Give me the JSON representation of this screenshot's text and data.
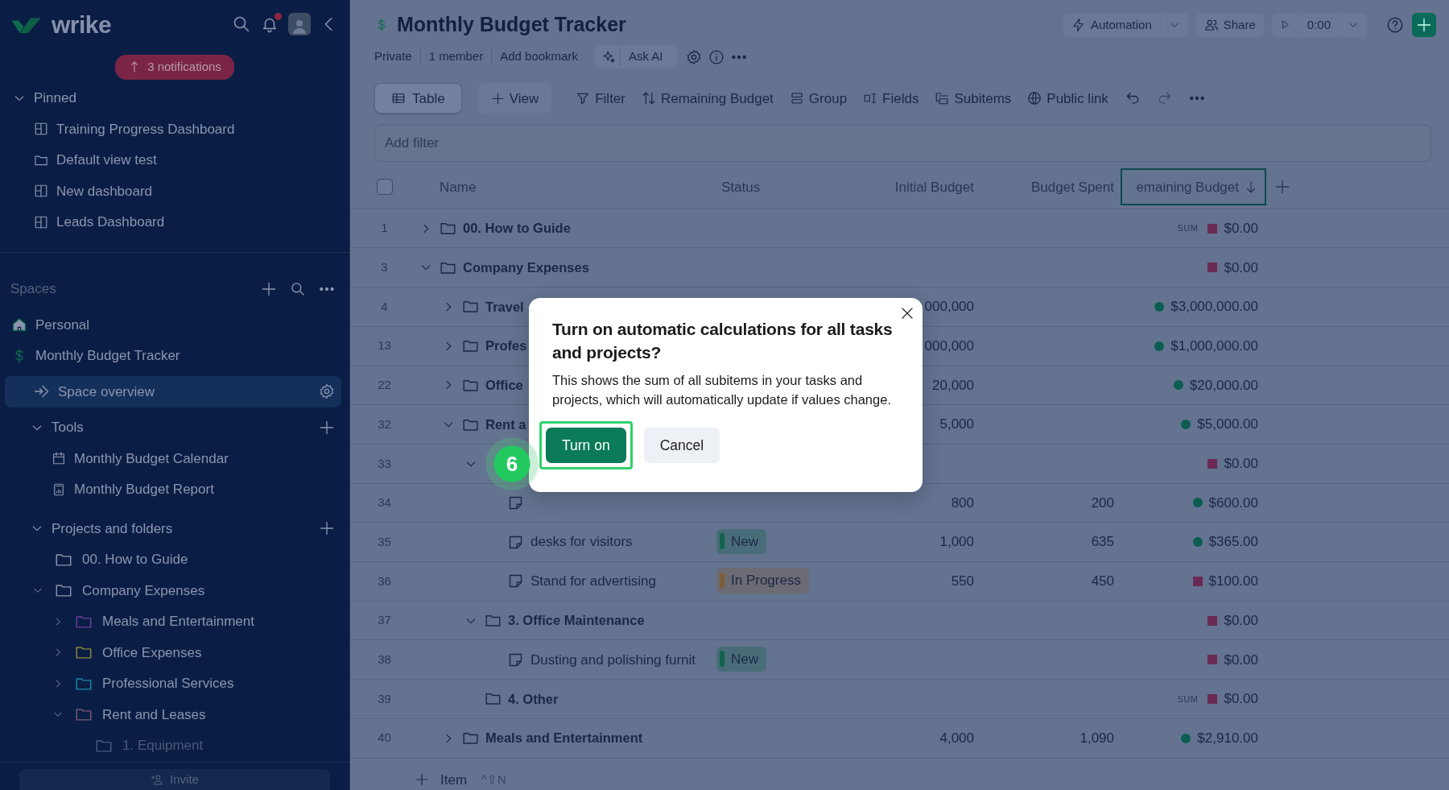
{
  "sidebar": {
    "logo": "wrike",
    "notifications": "3 notifications",
    "pinned": {
      "label": "Pinned",
      "expanded": true,
      "items": [
        {
          "kind": "dashboard",
          "label": "Training Progress Dashboard"
        },
        {
          "kind": "folder",
          "label": "Default view test"
        },
        {
          "kind": "dashboard",
          "label": "New dashboard"
        },
        {
          "kind": "dashboard",
          "label": "Leads Dashboard"
        }
      ]
    },
    "spaces_label": "Spaces",
    "spaces": [
      {
        "kind": "home",
        "label": "Personal"
      },
      {
        "kind": "dollar",
        "label": "Monthly Budget Tracker"
      }
    ],
    "space_overview": {
      "label": "Space overview",
      "selected": true
    },
    "tools": {
      "label": "Tools",
      "expanded": true,
      "items": [
        {
          "kind": "calendar",
          "label": "Monthly Budget Calendar"
        },
        {
          "kind": "report",
          "label": "Monthly Budget Report"
        }
      ]
    },
    "projects": {
      "label": "Projects and folders",
      "expanded": true,
      "children": [
        {
          "label": "00. How to Guide"
        },
        {
          "label": "Company Expenses",
          "expanded": true,
          "children": [
            {
              "label": "Meals and Entertainment",
              "expanded": false,
              "color": "#6a3f9a"
            },
            {
              "label": "Office Expenses",
              "expanded": false,
              "color": "#8c8a3c"
            },
            {
              "label": "Professional Services",
              "expanded": false,
              "color": "#1f87a6"
            },
            {
              "label": "Rent and Leases",
              "expanded": true,
              "color": "#7a5a78",
              "children": [
                {
                  "label": "1. Equipment",
                  "faded": true
                }
              ]
            }
          ]
        }
      ]
    },
    "invite": "Invite"
  },
  "header": {
    "title": "Monthly Budget Tracker",
    "meta": [
      "Private",
      "1 member",
      "Add bookmark"
    ],
    "ask_ai": "Ask AI",
    "automation": "Automation",
    "share": "Share",
    "timer": "0:00"
  },
  "toolbar": {
    "tabs": [
      {
        "label": "Table",
        "selected": true
      }
    ],
    "add_view": "View",
    "tools": [
      {
        "kind": "filter",
        "label": "Filter"
      },
      {
        "kind": "sort",
        "label": "Remaining Budget"
      },
      {
        "kind": "group",
        "label": "Group"
      },
      {
        "kind": "fields",
        "label": "Fields"
      },
      {
        "kind": "subitems",
        "label": "Subitems"
      },
      {
        "kind": "globe",
        "label": "Public link"
      }
    ]
  },
  "filter": {
    "placeholder": "Add filter"
  },
  "table": {
    "select_all": {
      "checked": false
    },
    "columns": [
      {
        "label": "Name",
        "selected": false
      },
      {
        "label": "Status",
        "selected": false
      },
      {
        "label": "Initial Budget",
        "selected": false
      },
      {
        "label": "Budget Spent",
        "selected": false
      },
      {
        "label": "emaining Budget",
        "selected": true
      }
    ],
    "rows": [
      {
        "number": "1",
        "kind": "folder",
        "name": "00. How to Guide",
        "expanded": false,
        "sum": "SUM",
        "remaining": "$0.00",
        "indicator": {
          "kind": "square",
          "color": "#6a2a55"
        }
      },
      {
        "number": "3",
        "kind": "folder",
        "name": "Company Expenses",
        "expanded": true,
        "remaining": "$0.00",
        "indicator": {
          "kind": "square",
          "color": "#6a2a55"
        },
        "children": [
          {
            "number": "4",
            "kind": "folder",
            "name": "Travel",
            "expanded": false,
            "initial": "000,000",
            "remaining": "$3,000,000.00",
            "indicator": {
              "kind": "dot",
              "color": "#0b5d51"
            }
          },
          {
            "number": "13",
            "kind": "folder",
            "name": "Profes",
            "expanded": false,
            "initial": "000,000",
            "remaining": "$1,000,000.00",
            "indicator": {
              "kind": "dot",
              "color": "#0b5d51"
            }
          },
          {
            "number": "22",
            "kind": "folder",
            "name": "Office",
            "expanded": false,
            "initial": "20,000",
            "remaining": "$20,000.00",
            "indicator": {
              "kind": "dot",
              "color": "#0b5d51"
            }
          },
          {
            "number": "32",
            "kind": "folder",
            "name": "Rent a",
            "expanded": true,
            "initial": "5,000",
            "remaining": "$5,000.00",
            "indicator": {
              "kind": "dot",
              "color": "#0b5d51"
            },
            "children": [
              {
                "number": "33",
                "kind": "folder",
                "expanded": true,
                "remaining": "$0.00",
                "indicator": {
                  "kind": "square",
                  "color": "#6a2a55"
                },
                "children": [
                  {
                    "number": "34",
                    "kind": "task",
                    "initial": "800",
                    "spent": "200",
                    "remaining": "$600.00",
                    "indicator": {
                      "kind": "dot",
                      "color": "#0b5d51"
                    }
                  },
                  {
                    "number": "35",
                    "kind": "task",
                    "name": "desks for visitors",
                    "status": {
                      "label": "New",
                      "color": "#12634a"
                    },
                    "initial": "1,000",
                    "spent": "635",
                    "remaining": "$365.00",
                    "indicator": {
                      "kind": "dot",
                      "color": "#0b5d51"
                    }
                  },
                  {
                    "number": "36",
                    "kind": "task",
                    "name": "Stand for advertising",
                    "status": {
                      "label": "In Progress",
                      "color": "#7d5d3a"
                    },
                    "initial": "550",
                    "spent": "450",
                    "remaining": "$100.00",
                    "indicator": {
                      "kind": "square",
                      "color": "#6a2a55"
                    }
                  }
                ]
              },
              {
                "number": "37",
                "kind": "folder",
                "name": "3. Office Maintenance",
                "expanded": true,
                "remaining": "$0.00",
                "indicator": {
                  "kind": "square",
                  "color": "#6a2a55"
                },
                "children": [
                  {
                    "number": "38",
                    "kind": "task",
                    "name": "Dusting and polishing furnit",
                    "status": {
                      "label": "New",
                      "color": "#12634a"
                    },
                    "remaining": "$0.00",
                    "indicator": {
                      "kind": "square",
                      "color": "#6a2a55"
                    }
                  }
                ]
              },
              {
                "number": "39",
                "kind": "folder",
                "name": "4. Other",
                "sum": "SUM",
                "remaining": "$0.00",
                "indicator": {
                  "kind": "square",
                  "color": "#6a2a55"
                }
              }
            ]
          },
          {
            "number": "40",
            "kind": "folder",
            "name": "Meals and Entertainment",
            "expanded": false,
            "initial": "4,000",
            "spent": "1,090",
            "remaining": "$2,910.00",
            "indicator": {
              "kind": "dot",
              "color": "#0b5d51"
            }
          }
        ]
      }
    ],
    "add_item": "Item",
    "shortcut": "^⇧N"
  },
  "dialog": {
    "title": "Turn on automatic calculations for all tasks and projects?",
    "body": "This shows the sum of all subitems in your tasks and projects, which will automatically update if values change.",
    "confirm": "Turn on",
    "cancel": "Cancel",
    "step": "6"
  }
}
